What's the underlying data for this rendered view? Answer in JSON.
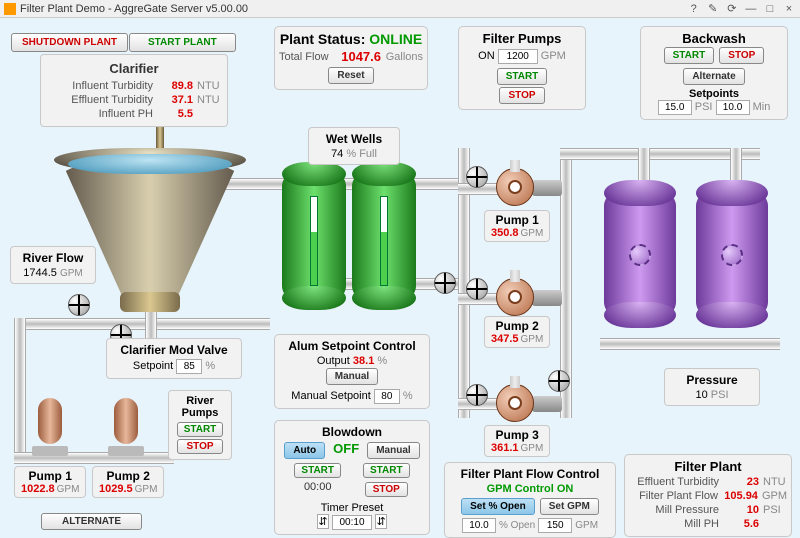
{
  "window": {
    "title": "Filter Plant Demo - AggreGate Server v5.00.00"
  },
  "top_buttons": {
    "shutdown": "SHUTDOWN PLANT",
    "start": "START PLANT"
  },
  "plant_status": {
    "label": "Plant Status:",
    "status": "ONLINE",
    "total_flow_label": "Total Flow",
    "total_flow_value": "1047.6",
    "total_flow_unit": "Gallons",
    "reset": "Reset"
  },
  "filter_pumps": {
    "title": "Filter Pumps",
    "on_label": "ON",
    "gpm_value": "1200",
    "gpm_unit": "GPM",
    "start": "START",
    "stop": "STOP"
  },
  "backwash": {
    "title": "Backwash",
    "start": "START",
    "stop": "STOP",
    "alternate": "Alternate",
    "setpoints": "Setpoints",
    "val1": "15.0",
    "unit1": "PSI",
    "val2": "10.0",
    "unit2": "Min"
  },
  "clarifier": {
    "title": "Clarifier",
    "row1_label": "Influent Turbidity",
    "row1_value": "89.8",
    "row1_unit": "NTU",
    "row2_label": "Effluent Turbidity",
    "row2_value": "37.1",
    "row2_unit": "NTU",
    "row3_label": "Influent PH",
    "row3_value": "5.5",
    "row3_unit": ""
  },
  "wet_wells": {
    "title": "Wet Wells",
    "value": "74",
    "unit": "% Full"
  },
  "river_flow": {
    "title": "River Flow",
    "value": "1744.5",
    "unit": "GPM"
  },
  "clarifier_mod_valve": {
    "title": "Clarifier Mod Valve",
    "setpoint_label": "Setpoint",
    "setpoint_value": "85",
    "setpoint_unit": "%"
  },
  "river_pumps": {
    "title": "River Pumps",
    "start": "START",
    "stop": "STOP"
  },
  "pump_1": {
    "name": "Pump 1",
    "value": "1022.8",
    "unit": "GPM"
  },
  "pump_2": {
    "name": "Pump 2",
    "value": "1029.5",
    "unit": "GPM"
  },
  "alternate": "ALTERNATE",
  "alum": {
    "title": "Alum Setpoint Control",
    "output_label": "Output",
    "output_value": "38.1",
    "output_unit": "%",
    "manual": "Manual",
    "manual_sp_label": "Manual Setpoint",
    "manual_sp_value": "80",
    "manual_sp_unit": "%"
  },
  "blowdown": {
    "title": "Blowdown",
    "auto": "Auto",
    "status": "OFF",
    "manual": "Manual",
    "start": "START",
    "stop": "STOP",
    "timer": "00:00",
    "preset_label": "Timer Preset",
    "preset_value": "00:10"
  },
  "fpump1": {
    "name": "Pump 1",
    "value": "350.8",
    "unit": "GPM"
  },
  "fpump2": {
    "name": "Pump 2",
    "value": "347.5",
    "unit": "GPM"
  },
  "fpump3": {
    "name": "Pump 3",
    "value": "361.1",
    "unit": "GPM"
  },
  "pressure": {
    "title": "Pressure",
    "value": "10",
    "unit": "PSI"
  },
  "flow_control": {
    "title": "Filter Plant Flow Control",
    "status": "GPM Control ON",
    "set_pct": "Set % Open",
    "set_gpm": "Set GPM",
    "pct_value": "10.0",
    "pct_unit": "% Open",
    "gpm_value": "150",
    "gpm_unit": "GPM"
  },
  "filter_plant": {
    "title": "Filter Plant",
    "r1_label": "Effluent Turbidity",
    "r1_value": "23",
    "r1_unit": "NTU",
    "r2_label": "Filter Plant Flow",
    "r2_value": "105.94",
    "r2_unit": "GPM",
    "r3_label": "Mill Pressure",
    "r3_value": "10",
    "r3_unit": "PSI",
    "r4_label": "Mill PH",
    "r4_value": "5.6",
    "r4_unit": ""
  }
}
